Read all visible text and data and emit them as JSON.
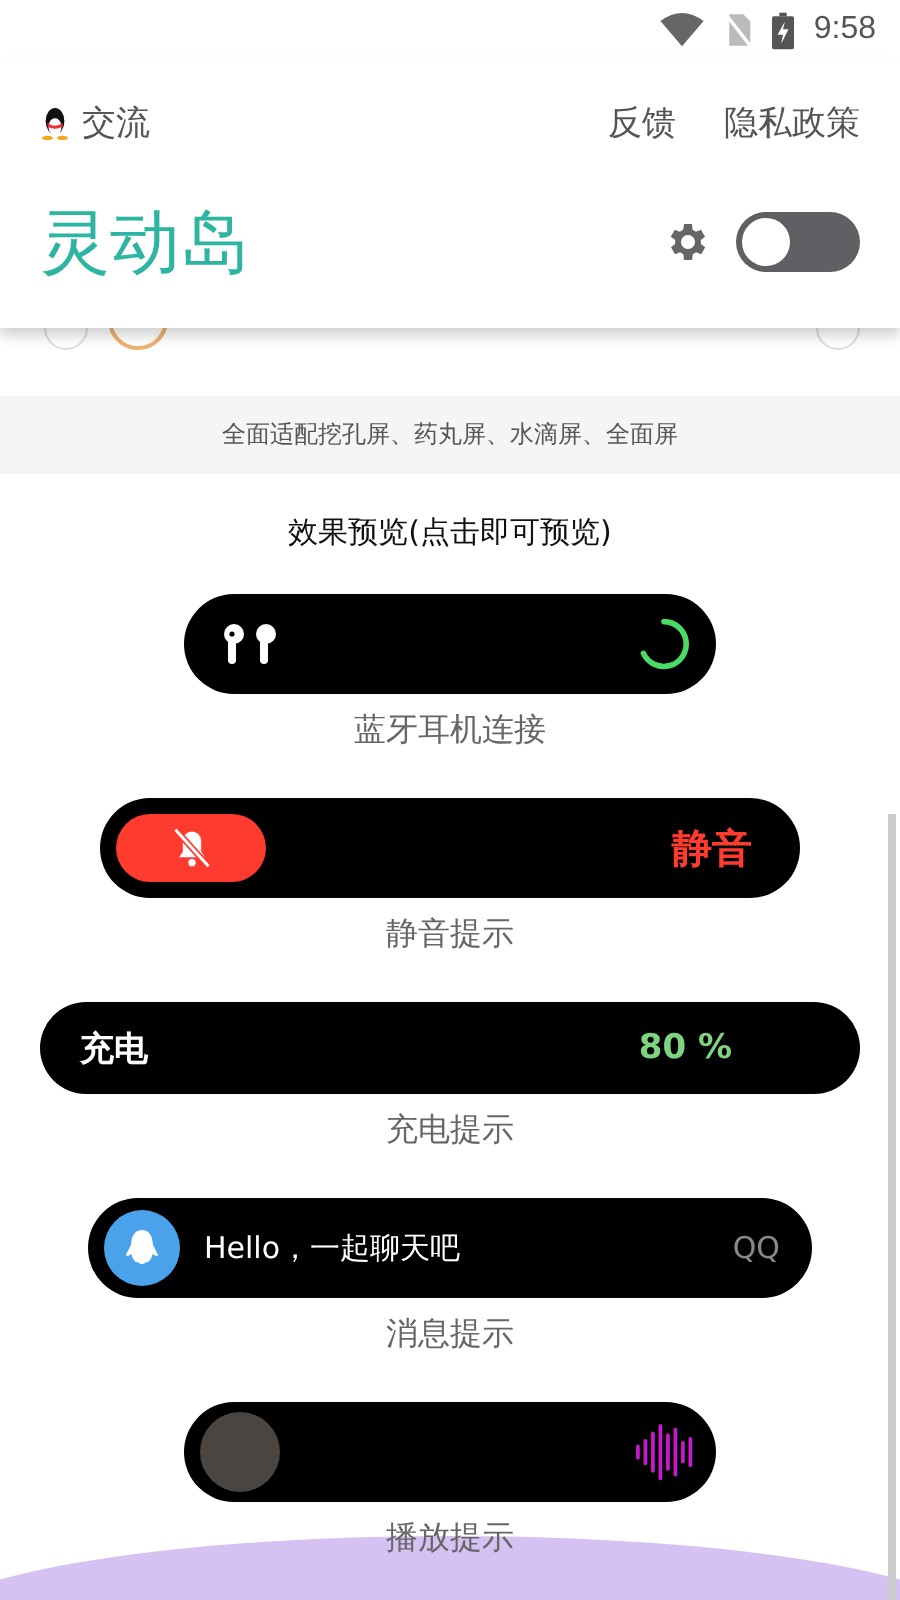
{
  "status_bar": {
    "time": "9:58"
  },
  "header": {
    "community_link": "交流",
    "links": [
      "反馈",
      "隐私政策"
    ],
    "title": "灵动岛",
    "enabled": false
  },
  "options": [
    {
      "color": "#dddddd"
    },
    {
      "color": "#f0b070"
    },
    {
      "color": "#dddddd"
    }
  ],
  "notice": "全面适配挖孔屏、药丸屏、水滴屏、全面屏",
  "preview_title": "效果预览(点击即可预览)",
  "previews": [
    {
      "kind": "bluetooth",
      "label": "蓝牙耳机连接"
    },
    {
      "kind": "mute",
      "text": "静音",
      "label": "静音提示"
    },
    {
      "kind": "charge",
      "text": "充电",
      "reading": "80 %",
      "label": "充电提示"
    },
    {
      "kind": "message",
      "text": "Hello，一起聊天吧",
      "app": "QQ",
      "label": "消息提示"
    },
    {
      "kind": "music",
      "label": "播放提示"
    }
  ]
}
